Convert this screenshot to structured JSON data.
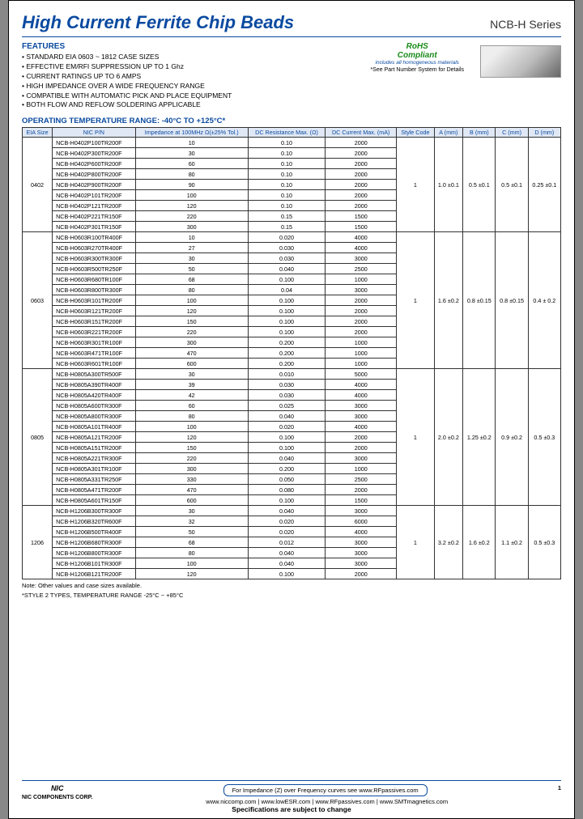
{
  "header": {
    "title": "High Current Ferrite Chip Beads",
    "series": "NCB-H Series"
  },
  "features": {
    "heading": "FEATURES",
    "items": [
      "STANDARD EIA 0603 ~ 1812 CASE SIZES",
      "EFFECTIVE EM/RFI SUPPRESSION UP TO 1 Ghz",
      "CURRENT RATINGS UP TO 6 AMPS",
      "HIGH IMPEDANCE OVER A WIDE FREQUENCY RANGE",
      "COMPATIBLE WITH AUTOMATIC PICK AND PLACE EQUIPMENT",
      "BOTH FLOW AND REFLOW SOLDERING APPLICABLE"
    ]
  },
  "rohs": {
    "title": "RoHS",
    "compliant": "Compliant",
    "sub": "includes all homogeneous materials",
    "note": "*See Part Number System for Details"
  },
  "temp_range": "OPERATING TEMPERATURE RANGE: -40°C TO +125°C*",
  "table": {
    "headers": [
      "EIA Size",
      "NIC P/N",
      "Impedance at 100MHz Ω(±25% Tol.)",
      "DC Resistance Max. (Ω)",
      "DC Current Max. (mA)",
      "Style Code",
      "A (mm)",
      "B (mm)",
      "C (mm)",
      "D (mm)"
    ],
    "groups": [
      {
        "size": "0402",
        "style": "1",
        "a": "1.0 ±0.1",
        "b": "0.5 ±0.1",
        "c": "0.5 ±0.1",
        "d": "0.25 ±0.1",
        "rows": [
          {
            "pn": "NCB-H0402P100TR200F",
            "imp": "10",
            "dcr": "0.10",
            "dci": "2000"
          },
          {
            "pn": "NCB-H0402P300TR200F",
            "imp": "30",
            "dcr": "0.10",
            "dci": "2000"
          },
          {
            "pn": "NCB-H0402P600TR200F",
            "imp": "60",
            "dcr": "0.10",
            "dci": "2000"
          },
          {
            "pn": "NCB-H0402P800TR200F",
            "imp": "80",
            "dcr": "0.10",
            "dci": "2000"
          },
          {
            "pn": "NCB-H0402P900TR200F",
            "imp": "90",
            "dcr": "0.10",
            "dci": "2000"
          },
          {
            "pn": "NCB-H0402P101TR200F",
            "imp": "100",
            "dcr": "0.10",
            "dci": "2000"
          },
          {
            "pn": "NCB-H0402P121TR200F",
            "imp": "120",
            "dcr": "0.10",
            "dci": "2000"
          },
          {
            "pn": "NCB-H0402P221TR150F",
            "imp": "220",
            "dcr": "0.15",
            "dci": "1500"
          },
          {
            "pn": "NCB-H0402P301TR150F",
            "imp": "300",
            "dcr": "0.15",
            "dci": "1500"
          }
        ]
      },
      {
        "size": "0603",
        "style": "1",
        "a": "1.6 ±0.2",
        "b": "0.8 ±0.15",
        "c": "0.8 ±0.15",
        "d": "0.4 ± 0.2",
        "rows": [
          {
            "pn": "NCB-H0603R100TR400F",
            "imp": "10",
            "dcr": "0.020",
            "dci": "4000"
          },
          {
            "pn": "NCB-H0603R270TR400F",
            "imp": "27",
            "dcr": "0.030",
            "dci": "4000"
          },
          {
            "pn": "NCB-H0603R300TR300F",
            "imp": "30",
            "dcr": "0.030",
            "dci": "3000"
          },
          {
            "pn": "NCB-H0603R500TR250F",
            "imp": "50",
            "dcr": "0.040",
            "dci": "2500"
          },
          {
            "pn": "NCB-H0603R680TR100F",
            "imp": "68",
            "dcr": "0.100",
            "dci": "1000"
          },
          {
            "pn": "NCB-H0603R800TR300F",
            "imp": "80",
            "dcr": "0.04",
            "dci": "3000"
          },
          {
            "pn": "NCB-H0603R101TR200F",
            "imp": "100",
            "dcr": "0.100",
            "dci": "2000"
          },
          {
            "pn": "NCB-H0603R121TR200F",
            "imp": "120",
            "dcr": "0.100",
            "dci": "2000"
          },
          {
            "pn": "NCB-H0603R151TR200F",
            "imp": "150",
            "dcr": "0.100",
            "dci": "2000"
          },
          {
            "pn": "NCB-H0603R221TR200F",
            "imp": "220",
            "dcr": "0.100",
            "dci": "2000"
          },
          {
            "pn": "NCB-H0603R301TR100F",
            "imp": "300",
            "dcr": "0.200",
            "dci": "1000"
          },
          {
            "pn": "NCB-H0603R471TR100F",
            "imp": "470",
            "dcr": "0.200",
            "dci": "1000"
          },
          {
            "pn": "NCB-H0603R601TR100F",
            "imp": "600",
            "dcr": "0.200",
            "dci": "1000"
          }
        ]
      },
      {
        "size": "0805",
        "style": "1",
        "a": "2.0 ±0.2",
        "b": "1.25 ±0.2",
        "c": "0.9 ±0.2",
        "d": "0.5 ±0.3",
        "rows": [
          {
            "pn": "NCB-H0805A300TR500F",
            "imp": "30",
            "dcr": "0.010",
            "dci": "5000"
          },
          {
            "pn": "NCB-H0805A390TR400F",
            "imp": "39",
            "dcr": "0.030",
            "dci": "4000"
          },
          {
            "pn": "NCB-H0805A420TR400F",
            "imp": "42",
            "dcr": "0.030",
            "dci": "4000"
          },
          {
            "pn": "NCB-H0805A600TR300F",
            "imp": "60",
            "dcr": "0.025",
            "dci": "3000"
          },
          {
            "pn": "NCB-H0805A800TR300F",
            "imp": "80",
            "dcr": "0.040",
            "dci": "3000"
          },
          {
            "pn": "NCB-H0805A101TR400F",
            "imp": "100",
            "dcr": "0.020",
            "dci": "4000"
          },
          {
            "pn": "NCB-H0805A121TR200F",
            "imp": "120",
            "dcr": "0.100",
            "dci": "2000"
          },
          {
            "pn": "NCB-H0805A151TR200F",
            "imp": "150",
            "dcr": "0.100",
            "dci": "2000"
          },
          {
            "pn": "NCB-H0805A221TR300F",
            "imp": "220",
            "dcr": "0.040",
            "dci": "3000"
          },
          {
            "pn": "NCB-H0805A301TR100F",
            "imp": "300",
            "dcr": "0.200",
            "dci": "1000"
          },
          {
            "pn": "NCB-H0805A331TR250F",
            "imp": "330",
            "dcr": "0.050",
            "dci": "2500"
          },
          {
            "pn": "NCB-H0805A471TR200F",
            "imp": "470",
            "dcr": "0.080",
            "dci": "2000"
          },
          {
            "pn": "NCB-H0805A601TR150F",
            "imp": "600",
            "dcr": "0.100",
            "dci": "1500"
          }
        ]
      },
      {
        "size": "1206",
        "style": "1",
        "a": "3.2 ±0.2",
        "b": "1.6 ±0.2",
        "c": "1.1 ±0.2",
        "d": "0.5 ±0.3",
        "rows": [
          {
            "pn": "NCB-H1206B300TR300F",
            "imp": "30",
            "dcr": "0.040",
            "dci": "3000"
          },
          {
            "pn": "NCB-H1206B320TR600F",
            "imp": "32",
            "dcr": "0.020",
            "dci": "6000"
          },
          {
            "pn": "NCB-H1206B500TR400F",
            "imp": "50",
            "dcr": "0.020",
            "dci": "4000"
          },
          {
            "pn": "NCB-H1206B680TR300F",
            "imp": "68",
            "dcr": "0.012",
            "dci": "3000"
          },
          {
            "pn": "NCB-H1206B800TR300F",
            "imp": "80",
            "dcr": "0.040",
            "dci": "3000"
          },
          {
            "pn": "NCB-H1206B101TR300F",
            "imp": "100",
            "dcr": "0.040",
            "dci": "3000"
          },
          {
            "pn": "NCB-H1206B121TR200F",
            "imp": "120",
            "dcr": "0.100",
            "dci": "2000"
          }
        ]
      }
    ]
  },
  "notes": {
    "avail": "Note: Other values and case sizes available.",
    "style2": "*STYLE 2 TYPES, TEMPERATURE RANGE -25°C ~ +85°C"
  },
  "footer": {
    "logo_top": "NIC",
    "logo_bottom": "NIC COMPONENTS CORP.",
    "imp_box": "For Impedance (Z) over Frequency curves see www.RFpassives.com",
    "links": "www.niccomp.com  |  www.lowESR.com  |  www.RFpassives.com  |  www.SMTmagnetics.com",
    "spec_note": "Specifications are subject to change",
    "pageno": "1"
  }
}
